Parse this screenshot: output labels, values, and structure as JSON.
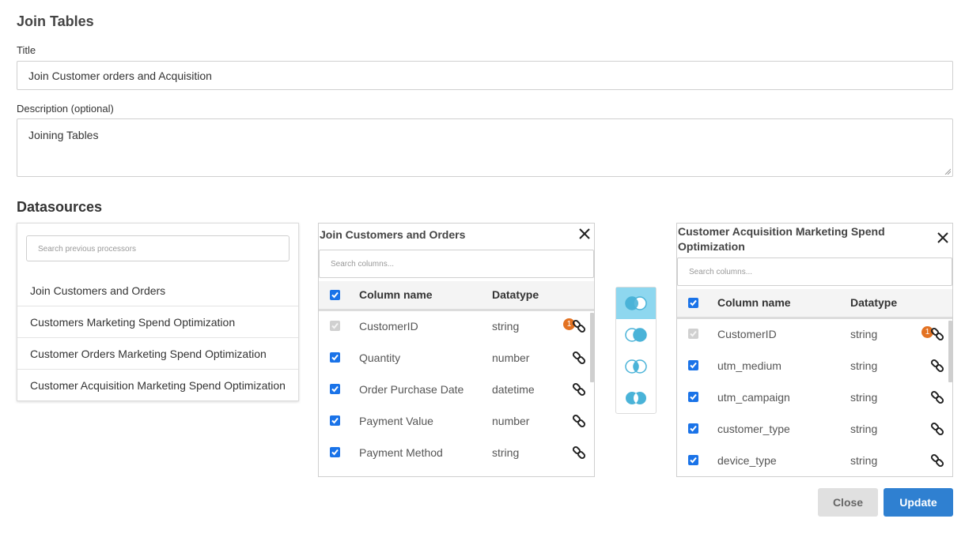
{
  "page": {
    "title": "Join Tables",
    "title_label": "Title",
    "title_value": "Join Customer orders and Acquisition",
    "description_label": "Description (optional)",
    "description_value": "Joining Tables",
    "datasources_heading": "Datasources"
  },
  "datasources": {
    "search_placeholder": "Search previous processors",
    "items": [
      "Join Customers and Orders",
      "Customers Marketing Spend Optimization",
      "Customer Orders Marketing Spend Optimization",
      "Customer Acquisition Marketing Spend Optimization"
    ]
  },
  "left_table": {
    "title": "Join Customers and Orders",
    "search_placeholder": "Search columns...",
    "col_name_header": "Column name",
    "col_type_header": "Datatype",
    "rows": [
      {
        "name": "CustomerID",
        "type": "string",
        "checked": true,
        "disabled": true,
        "badge": "1"
      },
      {
        "name": "Quantity",
        "type": "number",
        "checked": true
      },
      {
        "name": "Order Purchase Date",
        "type": "datetime",
        "checked": true
      },
      {
        "name": "Payment Value",
        "type": "number",
        "checked": true
      },
      {
        "name": "Payment Method",
        "type": "string",
        "checked": true
      }
    ]
  },
  "right_table": {
    "title": "Customer Acquisition Marketing Spend Optimization",
    "search_placeholder": "Search columns...",
    "col_name_header": "Column name",
    "col_type_header": "Datatype",
    "rows": [
      {
        "name": "CustomerID",
        "type": "string",
        "checked": true,
        "disabled": true,
        "badge": "1"
      },
      {
        "name": "utm_medium",
        "type": "string",
        "checked": true
      },
      {
        "name": "utm_campaign",
        "type": "string",
        "checked": true
      },
      {
        "name": "customer_type",
        "type": "string",
        "checked": true
      },
      {
        "name": "device_type",
        "type": "string",
        "checked": true
      }
    ]
  },
  "join_types": {
    "icons": [
      "left-join-icon",
      "right-join-icon",
      "inner-join-icon",
      "outer-join-icon"
    ],
    "active": "left-join-icon",
    "accent": "#4ab3d8"
  },
  "buttons": {
    "close": "Close",
    "update": "Update"
  },
  "colors": {
    "primary": "#2f80d1",
    "checkbox": "#1a73e8",
    "badge": "#e37222",
    "join_active_bg": "#8ed7ef"
  }
}
